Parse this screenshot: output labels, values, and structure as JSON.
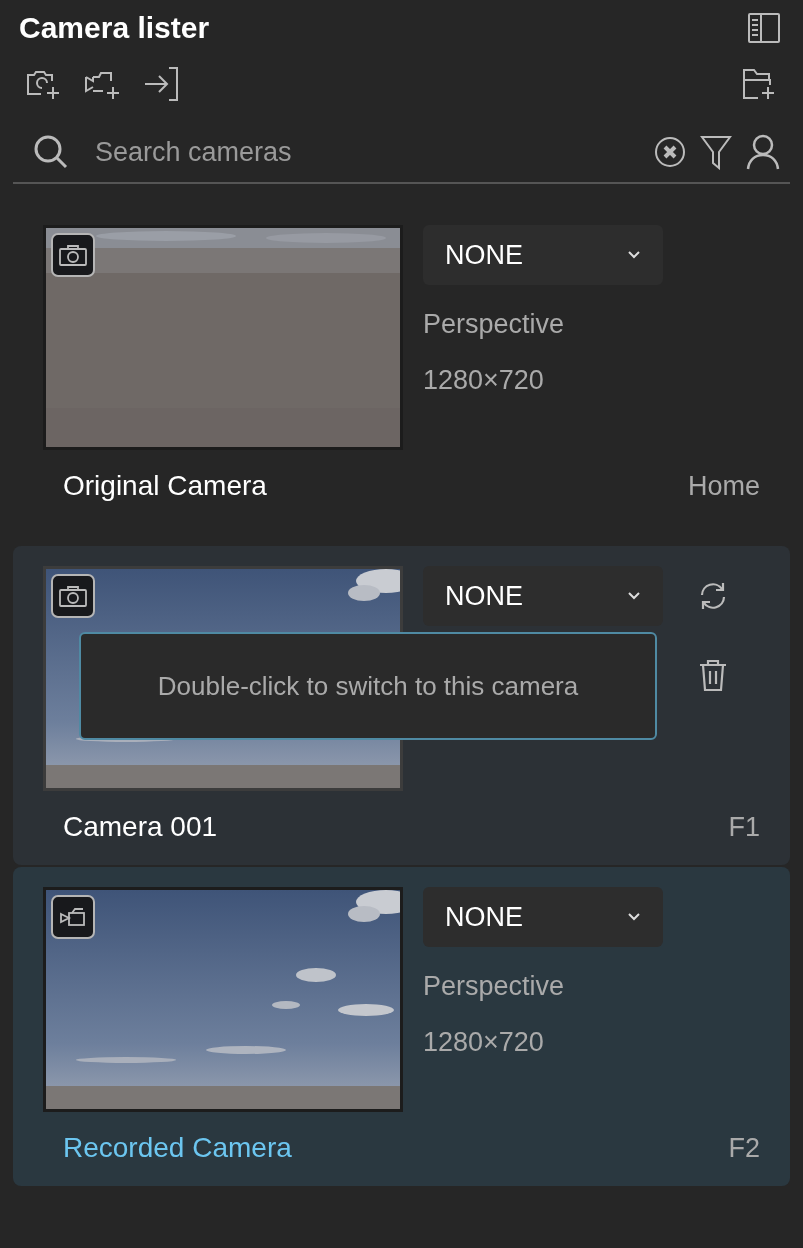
{
  "title": "Camera lister",
  "search": {
    "placeholder": "Search cameras"
  },
  "cameras": [
    {
      "name": "Original Camera",
      "clouds": false,
      "preset": "NONE",
      "projection": "Perspective",
      "resolution": "1280×720",
      "shortcut": "Home",
      "selected": false,
      "hovered": false
    },
    {
      "name": "Camera 001",
      "clouds": true,
      "preset": "NONE",
      "shortcut": "F1",
      "selected": false,
      "hovered": true,
      "tooltip": "Double-click to switch to this camera"
    },
    {
      "name": "Recorded Camera",
      "kind": "video",
      "clouds": true,
      "preset": "NONE",
      "projection": "Perspective",
      "resolution": "1280×720",
      "shortcut": "F2",
      "selected": true,
      "hovered": false
    }
  ]
}
